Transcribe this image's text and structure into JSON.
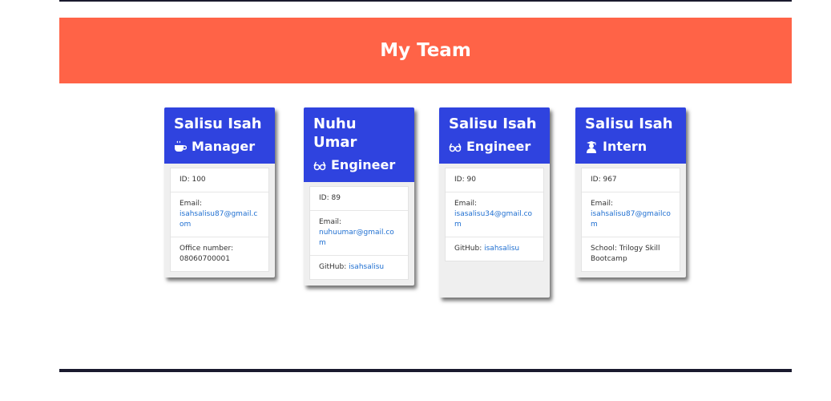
{
  "header": {
    "title": "My Team"
  },
  "colors": {
    "banner": "#ff6347",
    "card_header": "#2f43df"
  },
  "team": [
    {
      "name": "Salisu Isah",
      "role": "Manager",
      "icon": "coffee-icon",
      "id": "ID: 100",
      "email_label": "Email:",
      "email": "isahsalisu87@gmail.com",
      "extra_label": "Office number:",
      "extra_value": "08060700001"
    },
    {
      "name": "Nuhu Umar",
      "role": "Engineer",
      "icon": "glasses-icon",
      "id": "ID: 89",
      "email_label": "Email:",
      "email": "nuhuumar@gmail.com",
      "extra_label": "GitHub:",
      "extra_value": "isahsalisu"
    },
    {
      "name": "Salisu Isah",
      "role": "Engineer",
      "icon": "glasses-icon",
      "id": "ID: 90",
      "email_label": "Email:",
      "email": "isasalisu34@gmail.com",
      "extra_label": "GitHub:",
      "extra_value": "isahsalisu"
    },
    {
      "name": "Salisu Isah",
      "role": "Intern",
      "icon": "graduate-icon",
      "id": "ID: 967",
      "email_label": "Email:",
      "email": "isahsalisu87@gmailcom",
      "extra_label": "School:",
      "extra_value": "Trilogy Skill Bootcamp"
    }
  ]
}
